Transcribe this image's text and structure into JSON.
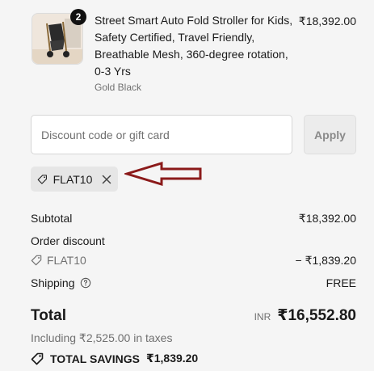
{
  "product": {
    "quantity": "2",
    "title": "Street Smart Auto Fold Stroller for Kids, Safety Certified, Travel Friendly, Breathable Mesh, 360-degree rotation, 0-3 Yrs",
    "variant": "Gold Black",
    "price": "₹18,392.00"
  },
  "discount": {
    "placeholder": "Discount code or gift card",
    "apply_label": "Apply",
    "applied_code": "FLAT10"
  },
  "summary": {
    "subtotal_label": "Subtotal",
    "subtotal_value": "₹18,392.00",
    "order_discount_label": "Order discount",
    "order_discount_code": "FLAT10",
    "order_discount_value": "− ₹1,839.20",
    "shipping_label": "Shipping",
    "shipping_value": "FREE",
    "total_label": "Total",
    "total_currency": "INR",
    "total_value": "₹16,552.80",
    "taxes_text": "Including ₹2,525.00 in taxes",
    "savings_label": "TOTAL SAVINGS",
    "savings_value": "₹1,839.20"
  },
  "colors": {
    "annotation_arrow": "#8b1a1a",
    "background": "#f5f5f5"
  }
}
